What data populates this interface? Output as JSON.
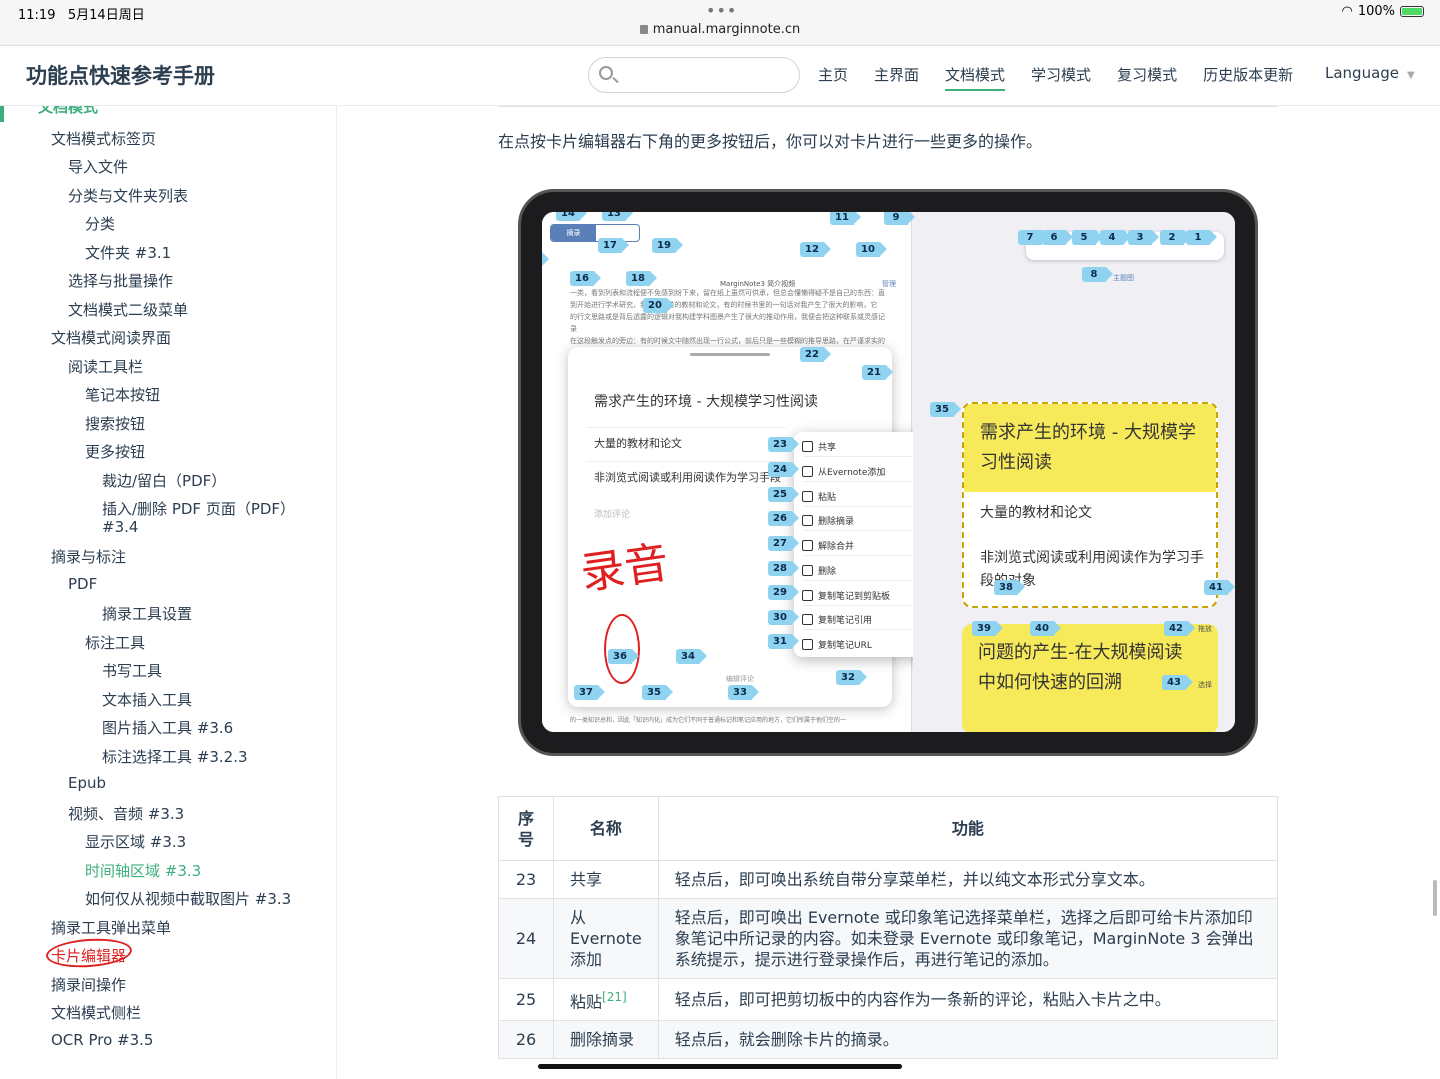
{
  "status_bar": {
    "time": "11:19",
    "date": "5月14日周日",
    "url": "manual.marginnote.cn",
    "battery": "100%"
  },
  "navbar": {
    "site_title": "功能点快速参考手册",
    "search_placeholder": "",
    "links": [
      "主页",
      "主界面",
      "文档模式",
      "学习模式",
      "复习模式",
      "历史版本更新"
    ],
    "active_link": "文档模式",
    "language": "Language"
  },
  "sidebar": {
    "top_item": "文档模式",
    "items": [
      {
        "label": "文档模式标签页",
        "level": 1
      },
      {
        "label": "导入文件",
        "level": 2
      },
      {
        "label": "分类与文件夹列表",
        "level": 2
      },
      {
        "label": "分类",
        "level": 3
      },
      {
        "label": "文件夹 #3.1",
        "level": 3
      },
      {
        "label": "选择与批量操作",
        "level": 2
      },
      {
        "label": "文档模式二级菜单",
        "level": 2
      },
      {
        "label": "文档模式阅读界面",
        "level": 1
      },
      {
        "label": "阅读工具栏",
        "level": 2
      },
      {
        "label": "笔记本按钮",
        "level": 3
      },
      {
        "label": "搜索按钮",
        "level": 3
      },
      {
        "label": "更多按钮",
        "level": 3
      },
      {
        "label": "裁边/留白（PDF）",
        "level": 4
      },
      {
        "label": "插入/删除 PDF 页面（PDF）",
        "level": 4
      },
      {
        "label": "#3.4",
        "level": 4
      },
      {
        "label": "摘录与标注",
        "level": 1
      },
      {
        "label": "PDF",
        "level": 2
      },
      {
        "label": "摘录工具设置",
        "level": 4
      },
      {
        "label": "标注工具",
        "level": 3
      },
      {
        "label": "书写工具",
        "level": 4
      },
      {
        "label": "文本插入工具",
        "level": 4
      },
      {
        "label": "图片插入工具 #3.6",
        "level": 4
      },
      {
        "label": "标注选择工具 #3.2.3",
        "level": 4
      },
      {
        "label": "Epub",
        "level": 2
      },
      {
        "label": "视频、音频 #3.3",
        "level": 2
      },
      {
        "label": "显示区域 #3.3",
        "level": 3
      },
      {
        "label": "时间轴区域 #3.3",
        "level": 3
      },
      {
        "label": "如何仅从视频中截取图片 #3.3",
        "level": 3
      },
      {
        "label": "摘录工具弹出菜单",
        "level": 1
      },
      {
        "label": "卡片编辑器",
        "level": 1
      },
      {
        "label": "摘录间操作",
        "level": 1
      },
      {
        "label": "文档模式侧栏",
        "level": 1
      },
      {
        "label": "OCR Pro #3.5",
        "level": 1
      }
    ]
  },
  "content": {
    "intro": "在点按卡片编辑器右下角的更多按钮后，你可以对卡片进行一些更多的操作。",
    "screenshot": {
      "seg_tabs": [
        "摘录",
        "标注"
      ],
      "doc_tab": "MarginNote3 简介视频",
      "manage": "管理",
      "mindmap_label": "主题图",
      "doc_lines": [
        "一类，看到列表和流程便不免感到纷下来，留在纸上虽然可供承，但总会懂懒得疑不是自己的东西：直",
        "到开始进行学术研究，我 20 大量的教材和论文，有的时候书里的一句话对我产生了很大的影响，它",
        "的行文思路或是背后透露的逻辑对我构建学科图景产生了很大的推动作用，我便会把这种联系或灵感记录",
        "在这段触发点的旁边：有的时候文中随然出现一行公式，前后只是一些模糊的推导思路，在严谨求实的学"
      ],
      "card_title": "需求产生的环境 - 大规模学习性阅读",
      "card_line1": "大量的教材和论文",
      "card_line2": "非浏览式阅读或利用阅读作为学习手段",
      "card_comment_hint": "添加评论",
      "card_edit_hint": "编辑评论",
      "handwriting": "录音",
      "menu_items": [
        "共享",
        "从Evernote添加",
        "粘贴",
        "删除摘录",
        "解除合并",
        "删除",
        "复制笔记到剪贴板",
        "复制笔记引用",
        "复制笔记URL"
      ],
      "sticky_title": "需求产生的环境 - 大规模学习性阅读",
      "sticky_line1": "大量的教材和论文",
      "sticky_line2": "非浏览式阅读或利用阅读作为学习手段的对象",
      "sticky2_title": "问题的产生-在大规模阅读中如何快速的回溯",
      "drag_label": "拖放",
      "select_label": "选择",
      "bottom_line": "的一类知识总和，因此「知识内化」成为它们不同于普通标记和笔记应用的地方，它们所属于他们空的一",
      "tags": [
        "14",
        "13",
        "11",
        "9",
        "15",
        "17",
        "19",
        "12",
        "10",
        "7",
        "6",
        "5",
        "4",
        "3",
        "2",
        "1",
        "16",
        "18",
        "8",
        "20",
        "22",
        "21",
        "35",
        "23",
        "24",
        "25",
        "26",
        "27",
        "28",
        "29",
        "30",
        "31",
        "36",
        "34",
        "32",
        "37",
        "35",
        "33",
        "38",
        "41",
        "39",
        "40",
        "42",
        "43"
      ]
    },
    "table": {
      "headers": [
        "序号",
        "名称",
        "功能"
      ],
      "rows": [
        {
          "num": "23",
          "name": "共享",
          "sup": "",
          "desc": "轻点后，即可唤出系统自带分享菜单栏，并以纯文本形式分享文本。"
        },
        {
          "num": "24",
          "name": "从 Evernote 添加",
          "sup": "",
          "desc": "轻点后，即可唤出 Evernote 或印象笔记选择菜单栏，选择之后即可给卡片添加印象笔记中所记录的内容。如未登录 Evernote 或印象笔记，MarginNote 3 会弹出系统提示，提示进行登录操作后，再进行笔记的添加。"
        },
        {
          "num": "25",
          "name": "粘贴",
          "sup": "[21]",
          "desc": "轻点后，即可把剪切板中的内容作为一条新的评论，粘贴入卡片之中。"
        },
        {
          "num": "26",
          "name": "删除摘录",
          "sup": "",
          "desc": "轻点后，就会删除卡片的摘录。"
        }
      ]
    }
  },
  "colors": {
    "accent": "#3eaf7c",
    "tag_blue": "#8fd3f1",
    "sticky_yellow": "#f7ea5a",
    "annotation_red": "#e02020"
  }
}
